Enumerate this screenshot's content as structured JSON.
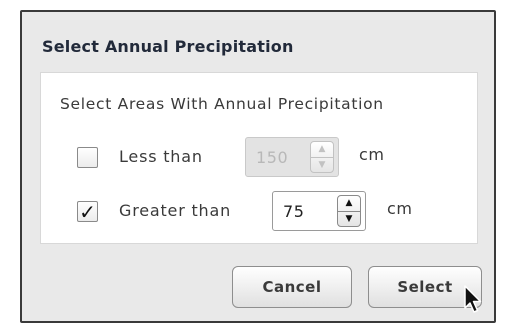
{
  "dialog": {
    "title": "Select Annual Precipitation",
    "panel_heading": "Select Areas With Annual Precipitation",
    "rows": [
      {
        "label": "Less than",
        "checked": false,
        "check_glyph": "",
        "value": "150",
        "unit": "cm",
        "enabled": false
      },
      {
        "label": "Greater than",
        "checked": true,
        "check_glyph": "✓",
        "value": "75",
        "unit": "cm",
        "enabled": true
      }
    ],
    "spin_up_glyph": "▲",
    "spin_down_glyph": "▼",
    "buttons": {
      "cancel": "Cancel",
      "select": "Select"
    }
  },
  "icons": {
    "checkbox_checked": "checkmark-icon",
    "spinner_up": "caret-up-icon",
    "spinner_down": "caret-down-icon",
    "cursor": "mouse-pointer-icon"
  },
  "colors": {
    "dialog_border": "#3a3a3a",
    "dialog_background": "#e9e9e9",
    "panel_background": "#ffffff",
    "disabled_field": "#e3e3e3",
    "title_text": "#222a3a"
  }
}
